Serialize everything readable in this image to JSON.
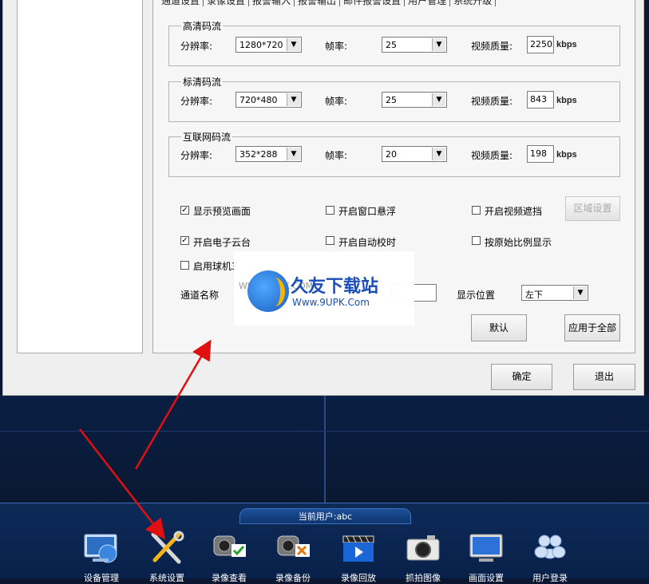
{
  "tabs": [
    "通道设置",
    "录像设置",
    "报警输入",
    "报警输出",
    "邮件报警设置",
    "用户管理",
    "系统升级"
  ],
  "hd_stream": {
    "title": "高清码流",
    "resolution_label": "分辨率:",
    "resolution": "1280*720",
    "fps_label": "帧率:",
    "fps": "25",
    "quality_label": "视频质量:",
    "quality": "2250",
    "unit": "kbps"
  },
  "sd_stream": {
    "title": "标清码流",
    "resolution_label": "分辨率:",
    "resolution": "720*480",
    "fps_label": "帧率:",
    "fps": "25",
    "quality_label": "视频质量:",
    "quality": "843",
    "unit": "kbps"
  },
  "net_stream": {
    "title": "互联网码流",
    "resolution_label": "分辨率:",
    "resolution": "352*288",
    "fps_label": "帧率:",
    "fps": "20",
    "quality_label": "视频质量:",
    "quality": "198",
    "unit": "kbps"
  },
  "options": {
    "show_preview": {
      "label": "显示预览画面",
      "checked": true
    },
    "window_float": {
      "label": "开启窗口悬浮",
      "checked": false
    },
    "video_mask": {
      "label": "开启视频遮挡",
      "checked": false
    },
    "area_settings": "区域设置",
    "ptz": {
      "label": "开启电子云台",
      "checked": true
    },
    "auto_time": {
      "label": "开启自动校时",
      "checked": false
    },
    "keep_ratio": {
      "label": "按原始比例显示",
      "checked": false
    },
    "dome": {
      "label": "启用球机3",
      "checked": false
    }
  },
  "channel_name_label": "通道名称",
  "display_pos_label": "显示位置",
  "display_pos": "左下",
  "buttons": {
    "default": "默认",
    "apply_all": "应用于全部",
    "ok": "确定",
    "exit": "退出"
  },
  "watermark": {
    "title": "久友下载站",
    "url": "Www.9UPK.Com",
    "faint": "WWW.9UPK.COM"
  },
  "taskbar": {
    "current_user": "当前用户:abc",
    "items": [
      "设备管理",
      "系统设置",
      "录像查看",
      "录像备份",
      "录像回放",
      "抓拍图像",
      "画面设置",
      "用户登录"
    ]
  },
  "colors": {
    "dialog_bg": "#efefef",
    "taskbar_bg": "#0d2a57",
    "arrow": "#e01010",
    "watermark_blue": "#1b4fb8"
  }
}
